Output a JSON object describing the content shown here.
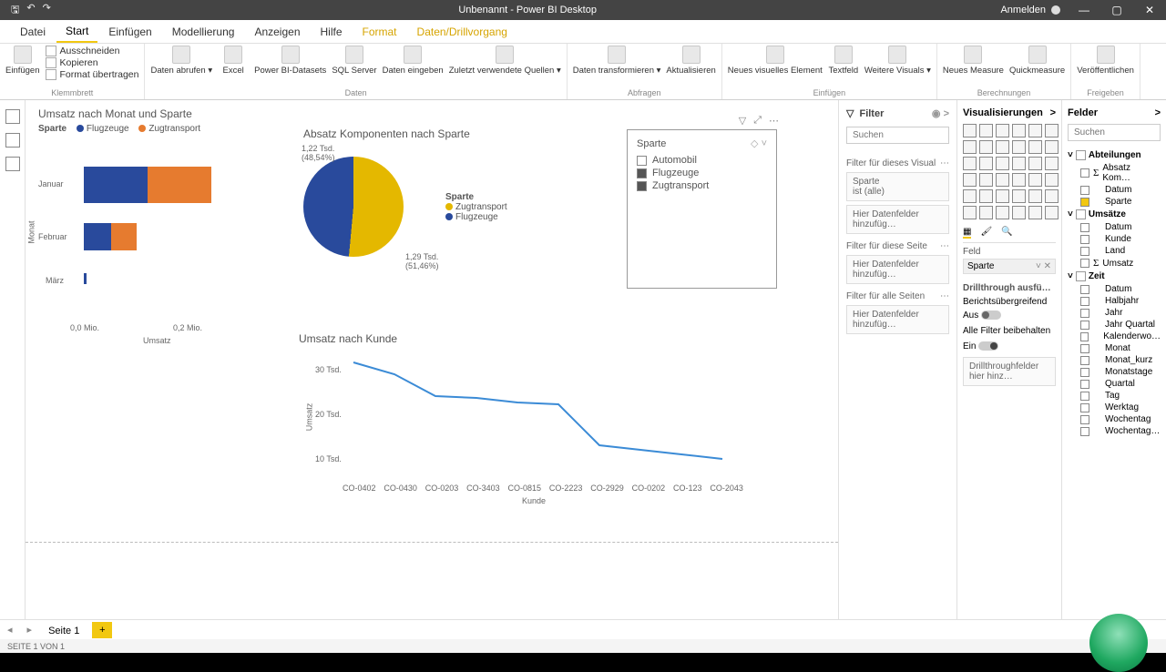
{
  "titlebar": {
    "title": "Unbenannt - Power BI Desktop",
    "login": "Anmelden"
  },
  "menu": {
    "file": "Datei",
    "home": "Start",
    "insert": "Einfügen",
    "model": "Modellierung",
    "view": "Anzeigen",
    "help": "Hilfe",
    "format": "Format",
    "datadrill": "Daten/Drillvorgang"
  },
  "ribbon": {
    "clip": {
      "cut": "Ausschneiden",
      "copy": "Kopieren",
      "fmt": "Format übertragen",
      "paste": "Einfügen",
      "group": "Klemmbrett"
    },
    "data": {
      "get": "Daten abrufen ▾",
      "excel": "Excel",
      "pbi": "Power BI-Datasets",
      "sql": "SQL Server",
      "enter": "Daten eingeben",
      "recent": "Zuletzt verwendete Quellen ▾",
      "group": "Daten"
    },
    "query": {
      "transform": "Daten transformieren ▾",
      "refresh": "Aktualisieren",
      "group": "Abfragen"
    },
    "ins": {
      "newviz": "Neues visuelles Element",
      "text": "Textfeld",
      "more": "Weitere Visuals ▾",
      "group": "Einfügen"
    },
    "calc": {
      "measure": "Neues Measure",
      "quick": "Quickmeasure",
      "group": "Berechnungen"
    },
    "share": {
      "publish": "Veröffentlichen",
      "group": "Freigeben"
    }
  },
  "visuals": {
    "bar": {
      "title": "Umsatz nach Monat und Sparte",
      "legend": "Sparte",
      "l1": "Flugzeuge",
      "l2": "Zugtransport",
      "jan": "Januar",
      "feb": "Februar",
      "mar": "März",
      "yaxis": "Monat",
      "xaxis": "Umsatz",
      "x0": "0,0 Mio.",
      "x1": "0,2 Mio."
    },
    "pie": {
      "title": "Absatz Komponenten nach Sparte",
      "legend": "Sparte",
      "l1": "Zugtransport",
      "l2": "Flugzeuge",
      "d1a": "1,22 Tsd.",
      "d1b": "(48,54%)",
      "d2a": "1,29 Tsd.",
      "d2b": "(51,46%)"
    },
    "slicer": {
      "title": "Sparte",
      "o1": "Automobil",
      "o2": "Flugzeuge",
      "o3": "Zugtransport"
    },
    "line": {
      "title": "Umsatz nach Kunde",
      "yaxis": "Umsatz",
      "xaxis": "Kunde",
      "y1": "30 Tsd.",
      "y2": "20 Tsd.",
      "y3": "10 Tsd.",
      "x": [
        "CO-0402",
        "CO-0430",
        "CO-0203",
        "CO-3403",
        "CO-0815",
        "CO-2223",
        "CO-2929",
        "CO-0202",
        "CO-123",
        "CO-2043"
      ]
    }
  },
  "filters": {
    "title": "Filter",
    "search": "Suchen",
    "visual": "Filter für dieses Visual",
    "card": "Sparte",
    "cardv": "ist (alle)",
    "page": "Filter für diese Seite",
    "all": "Filter für alle Seiten",
    "add": "Hier Datenfelder hinzufüg…"
  },
  "viz": {
    "title": "Visualisierungen",
    "fieldwell": "Feld",
    "fieldval": "Sparte",
    "drill": "Drillthrough ausfü…",
    "cross": "Berichtsübergreifend",
    "off": "Aus",
    "keep": "Alle Filter beibehalten",
    "on": "Ein",
    "drilladd": "Drillthroughfelder hier hinz…"
  },
  "fields": {
    "title": "Felder",
    "search": "Suchen",
    "tables": [
      {
        "name": "Abteilungen",
        "open": true,
        "fields": [
          {
            "n": "Absatz Kom…",
            "sum": true
          },
          {
            "n": "Datum"
          },
          {
            "n": "Sparte",
            "on": true
          }
        ]
      },
      {
        "name": "Umsätze",
        "open": true,
        "fields": [
          {
            "n": "Datum"
          },
          {
            "n": "Kunde"
          },
          {
            "n": "Land"
          },
          {
            "n": "Umsatz",
            "sum": true
          }
        ]
      },
      {
        "name": "Zeit",
        "open": true,
        "fields": [
          {
            "n": "Datum"
          },
          {
            "n": "Halbjahr"
          },
          {
            "n": "Jahr"
          },
          {
            "n": "Jahr Quartal"
          },
          {
            "n": "Kalenderwo…"
          },
          {
            "n": "Monat"
          },
          {
            "n": "Monat_kurz"
          },
          {
            "n": "Monatstage"
          },
          {
            "n": "Quartal"
          },
          {
            "n": "Tag"
          },
          {
            "n": "Werktag"
          },
          {
            "n": "Wochentag"
          },
          {
            "n": "Wochentag…"
          }
        ]
      }
    ]
  },
  "pagebar": {
    "page": "Seite 1"
  },
  "status": {
    "text": "SEITE 1 VON 1"
  },
  "chart_data": [
    {
      "type": "bar",
      "title": "Umsatz nach Monat und Sparte",
      "categories": [
        "Januar",
        "Februar",
        "März"
      ],
      "series": [
        {
          "name": "Flugzeuge",
          "values": [
            0.1,
            0.04,
            0.005
          ]
        },
        {
          "name": "Zugtransport",
          "values": [
            0.1,
            0.04,
            0
          ]
        }
      ],
      "xlabel": "Umsatz (Mio.)",
      "ylabel": "Monat",
      "xlim": [
        0,
        0.3
      ]
    },
    {
      "type": "pie",
      "title": "Absatz Komponenten nach Sparte",
      "categories": [
        "Zugtransport",
        "Flugzeuge"
      ],
      "values": [
        1290,
        1220
      ],
      "percent": [
        51.46,
        48.54
      ]
    },
    {
      "type": "line",
      "title": "Umsatz nach Kunde",
      "x": [
        "CO-0402",
        "CO-0430",
        "CO-0203",
        "CO-3403",
        "CO-0815",
        "CO-2223",
        "CO-2929",
        "CO-0202",
        "CO-123",
        "CO-2043"
      ],
      "values": [
        31,
        28,
        23,
        22.5,
        21.5,
        21,
        12,
        11,
        10,
        9
      ],
      "xlabel": "Kunde",
      "ylabel": "Umsatz (Tsd.)",
      "ylim": [
        0,
        35
      ]
    }
  ]
}
